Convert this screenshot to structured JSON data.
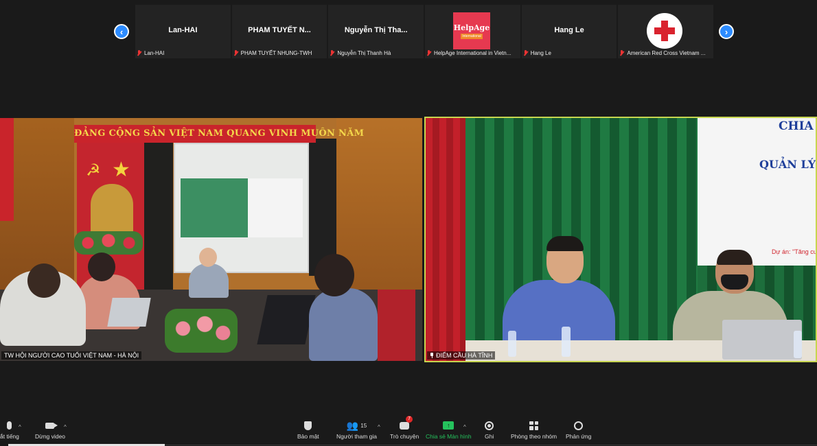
{
  "participants": [
    {
      "name": "Lan-HAI",
      "caption": "Lan-HAI",
      "type": "name"
    },
    {
      "name": "PHAM TUYẾT N...",
      "caption": "PHAM TUYẾT NHUNG-TWH",
      "type": "name"
    },
    {
      "name": "Nguyễn Thị Tha...",
      "caption": "Nguyễn Thị Thanh Hà",
      "type": "name"
    },
    {
      "name": "",
      "caption": "HelpAge International in Vietn...",
      "type": "logo-helpage",
      "logo_text": "HelpAge",
      "logo_sub": "International"
    },
    {
      "name": "Hang Le",
      "caption": "Hang Le",
      "type": "name"
    },
    {
      "name": "",
      "caption": "American Red Cross Vietnam ...",
      "type": "logo-redcross"
    }
  ],
  "nav": {
    "prev": "‹",
    "next": "›"
  },
  "videos": {
    "left": {
      "label": "TW HỘI NGƯỜI CAO TUỔI VIỆT NAM - HÀ NỘI",
      "banner": "ĐẢNG CỘNG SẢN VIỆT NAM QUANG VINH MUÔN NĂM"
    },
    "right": {
      "label": "ĐIỂM CẦU HÀ TĨNH",
      "board_line1": "CHIA S",
      "board_line2": "QUẢN LÝ",
      "board_line3": "Dự án: \"Tăng cường"
    }
  },
  "toolbar": {
    "mute": "ắt tiếng",
    "video": "Dừng video",
    "security": "Bảo mật",
    "participants": "Người tham gia",
    "participants_count": "15",
    "chat": "Trò chuyện",
    "chat_badge": "7",
    "share": "Chia sẻ Màn hình",
    "record": "Ghi",
    "breakout": "Phòng theo nhóm",
    "reactions": "Phản ứng",
    "caret": "^"
  },
  "colors": {
    "accent_blue": "#2d8cff",
    "share_green": "#25c25d",
    "active_speaker": "#c7d64f",
    "muted_red": "#e33333"
  }
}
